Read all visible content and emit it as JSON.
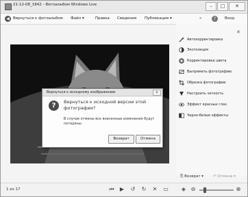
{
  "window": {
    "title": "21-12-08_1842 - Фотоальбом Windows Live",
    "minimize_icon": "minimize-icon",
    "maximize_icon": "maximize-icon",
    "close_icon": "close-icon"
  },
  "menubar": {
    "back_label": "Вернуться к фотоальбом",
    "items": [
      "Файл ▾",
      "Правка",
      "Сведения",
      "Публикация ▾"
    ],
    "overflow": "»",
    "help_icon": "help-icon",
    "signin": "Вход"
  },
  "side_panel": {
    "close_icon": "close-icon",
    "tools": [
      {
        "label": "Автокорректировка",
        "icon": "wand-icon"
      },
      {
        "label": "Экспозиция",
        "icon": "exposure-icon"
      },
      {
        "label": "Корректировка цвета",
        "icon": "color-icon"
      },
      {
        "label": "Выпрямить фотографию",
        "icon": "straighten-icon"
      },
      {
        "label": "Обрезка фотографии",
        "icon": "crop-icon"
      },
      {
        "label": "Настроить четкость",
        "icon": "sharpen-icon"
      },
      {
        "label": "Эффект красных глаз",
        "icon": "red-eye-icon"
      },
      {
        "label": "Черно-белые эффекты",
        "icon": "bw-effects-icon"
      }
    ],
    "revert": "Возврат ▾",
    "undo": "Отмена ▾"
  },
  "dialog": {
    "title": "Вернуться к исходному изображению",
    "heading": "Вернуться к исходной версии этой фотографии?",
    "body": "В случае отмены все внесенные изменения будут потеряны.",
    "buttons": {
      "revert": "Возврат",
      "cancel": "Отмена"
    },
    "close": "x"
  },
  "statusbar": {
    "counter": "1 из 17",
    "controls": [
      "first-icon",
      "play-icon",
      "rotate-left-icon",
      "rotate-right-icon",
      "delete-icon",
      "monitor-icon"
    ]
  }
}
